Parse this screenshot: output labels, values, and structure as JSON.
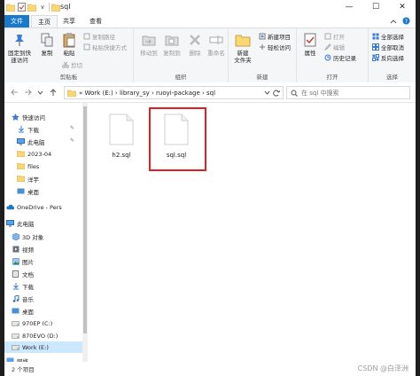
{
  "titlebar": {
    "title": "sql",
    "qat_separator": "∨",
    "buttons": {
      "minimize": "—",
      "maximize": "☐",
      "close": "✕"
    }
  },
  "tabs": {
    "file": "文件",
    "home": "主页",
    "share": "共享",
    "view": "查看"
  },
  "ribbon": {
    "clipboard": {
      "pin_quick": "固定到快\n速访问",
      "copy": "复制",
      "paste": "粘贴",
      "copy_path": "复制路径",
      "paste_shortcut": "粘贴快捷方式",
      "cut": "剪切",
      "group": "剪贴板"
    },
    "organize": {
      "move_to": "移动到",
      "copy_to": "复制到",
      "delete": "删除",
      "rename": "重命名",
      "group": "组织"
    },
    "new": {
      "new_folder": "新建\n文件夹",
      "new_item": "新建项目",
      "easy_access": "轻松访问",
      "group": "新建"
    },
    "open": {
      "properties": "属性",
      "open": "打开",
      "edit": "编辑",
      "history": "历史记录",
      "group": "打开"
    },
    "select": {
      "select_all": "全部选择",
      "select_none": "全部取消",
      "invert": "反向选择",
      "group": "选择"
    }
  },
  "address": {
    "path": "«  Work (E:)  ›  library_sy  ›  ruoyi-package  ›  sql",
    "search_placeholder": "在 sql 中搜索"
  },
  "nav": {
    "items": [
      {
        "label": "快速访问",
        "icon": "star-icon"
      },
      {
        "label": "下载",
        "icon": "download-icon",
        "pinned": true
      },
      {
        "label": "此电脑",
        "icon": "computer-icon",
        "pinned": true
      },
      {
        "label": "2023-04",
        "icon": "folder-icon"
      },
      {
        "label": "files",
        "icon": "folder-icon"
      },
      {
        "label": "洋芋",
        "icon": "folder-icon"
      },
      {
        "label": "桌面",
        "icon": "desktop-icon"
      },
      {
        "label": "OneDrive - Pers",
        "icon": "cloud-icon"
      },
      {
        "label": "此电脑",
        "icon": "computer-icon"
      },
      {
        "label": "3D 对象",
        "icon": "cube-icon"
      },
      {
        "label": "视频",
        "icon": "video-icon"
      },
      {
        "label": "图片",
        "icon": "image-icon"
      },
      {
        "label": "文档",
        "icon": "document-icon"
      },
      {
        "label": "下载",
        "icon": "download-icon"
      },
      {
        "label": "音乐",
        "icon": "music-icon"
      },
      {
        "label": "桌面",
        "icon": "desktop-icon"
      },
      {
        "label": "970EP (C:)",
        "icon": "drive-icon"
      },
      {
        "label": "870EVO (D:)",
        "icon": "drive-icon"
      },
      {
        "label": "Work (E:)",
        "icon": "drive-icon",
        "selected": true
      },
      {
        "label": "网络",
        "icon": "network-icon"
      }
    ]
  },
  "files": [
    {
      "name": "h2.sql",
      "icon": "file-icon"
    },
    {
      "name": "sql.sql",
      "icon": "file-icon",
      "highlighted": true
    }
  ],
  "status": {
    "count": "2 个项目"
  },
  "watermark": "CSDN @白泽洲",
  "colors": {
    "accent": "#1979ca",
    "selection": "#cce8ff",
    "highlight_box": "#e02020",
    "folder": "#f8d775"
  }
}
